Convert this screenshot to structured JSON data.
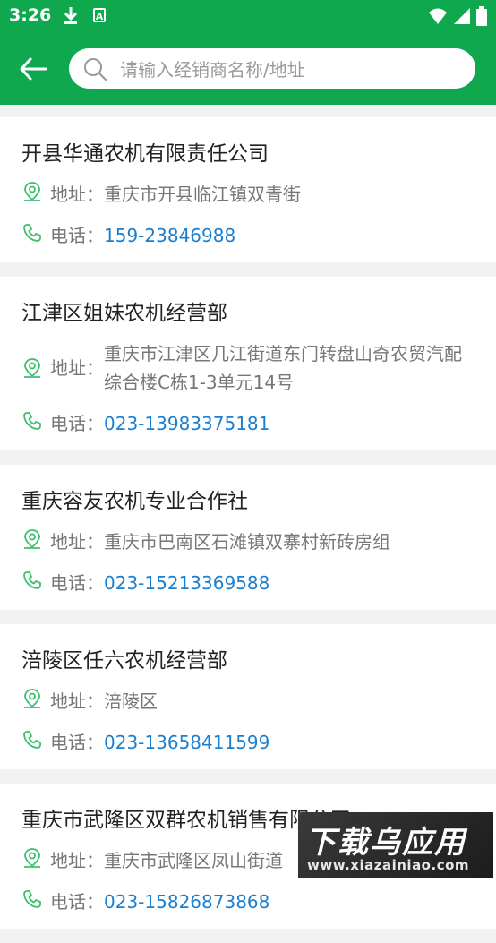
{
  "status": {
    "time": "3:26"
  },
  "search": {
    "placeholder": "请输入经销商名称/地址",
    "value": ""
  },
  "labels": {
    "address": "地址：",
    "phone": "电话："
  },
  "dealers": [
    {
      "name": "开县华通农机有限责任公司",
      "address": "重庆市开县临江镇双青街",
      "phone": "159-23846988"
    },
    {
      "name": "江津区姐妹农机经营部",
      "address": "重庆市江津区几江街道东门转盘山奇农贸汽配综合楼C栋1-3单元14号",
      "phone": "023-13983375181"
    },
    {
      "name": "重庆容友农机专业合作社",
      "address": "重庆市巴南区石滩镇双寨村新砖房组",
      "phone": "023-15213369588"
    },
    {
      "name": "涪陵区任六农机经营部",
      "address": "涪陵区",
      "phone": "023-13658411599"
    },
    {
      "name": "重庆市武隆区双群农机销售有限公司",
      "address": "重庆市武隆区凤山街道",
      "phone": "023-15826873868"
    }
  ],
  "watermark": {
    "title": "下载乌应用",
    "url": "www.xiazainiao.com"
  },
  "colors": {
    "primary": "#0fa84f",
    "link": "#1a7fd0",
    "icon": "#3cbf6e"
  }
}
